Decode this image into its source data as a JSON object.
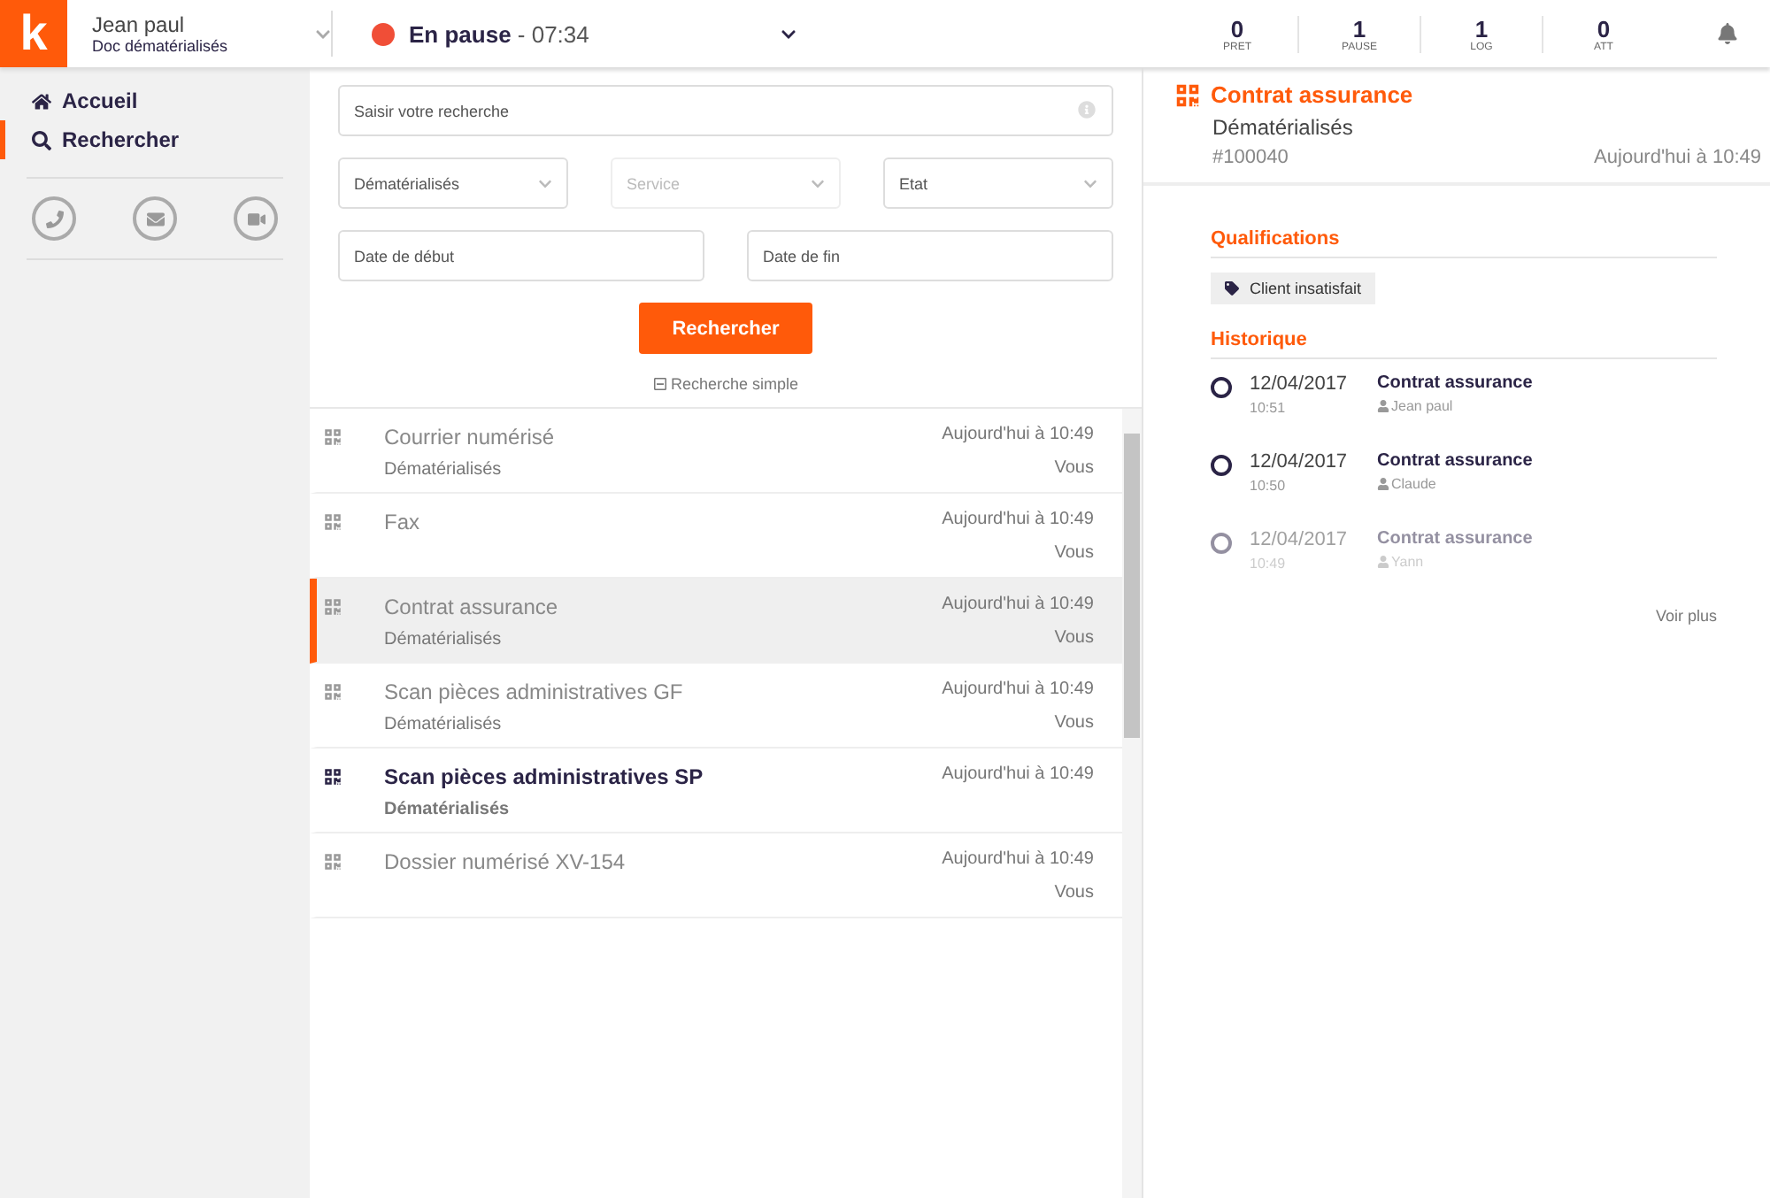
{
  "logo": "k",
  "user": {
    "name": "Jean paul",
    "group": "Doc dématérialisés"
  },
  "status": {
    "label": "En pause",
    "time": " - 07:34",
    "color": "#f04e37"
  },
  "counters": [
    {
      "value": "0",
      "label": "PRET"
    },
    {
      "value": "1",
      "label": "PAUSE"
    },
    {
      "value": "1",
      "label": "LOG"
    },
    {
      "value": "0",
      "label": "ATT"
    }
  ],
  "nav": [
    {
      "label": "Accueil",
      "selected": false
    },
    {
      "label": "Rechercher",
      "selected": true
    }
  ],
  "search": {
    "placeholder": "Saisir votre recherche",
    "selects": [
      {
        "value": "Dématérialisés",
        "disabled": false
      },
      {
        "placeholder": "Service",
        "disabled": true
      },
      {
        "value": "Etat",
        "disabled": false
      }
    ],
    "dates": [
      {
        "placeholder": "Date de début"
      },
      {
        "placeholder": "Date de fin"
      }
    ],
    "button": "Rechercher",
    "toggle": "Recherche simple"
  },
  "results": [
    {
      "title": "Courrier numérisé",
      "subtitle": "Dématérialisés",
      "time": "Aujourd'hui à 10:49",
      "author": "Vous",
      "selected": false,
      "unread": false
    },
    {
      "title": "Fax",
      "time": "Aujourd'hui à 10:49",
      "author": "Vous",
      "selected": false,
      "unread": false
    },
    {
      "title": "Contrat assurance",
      "subtitle": "Dématérialisés",
      "time": "Aujourd'hui à 10:49",
      "author": "Vous",
      "selected": true,
      "unread": false
    },
    {
      "title": "Scan pièces administratives GF",
      "subtitle": "Dématérialisés",
      "time": "Aujourd'hui à 10:49",
      "author": "Vous",
      "selected": false,
      "unread": false
    },
    {
      "title": "Scan pièces administratives SP",
      "subtitle": "Dématérialisés",
      "time": "Aujourd'hui à 10:49",
      "selected": false,
      "unread": true
    },
    {
      "title": "Dossier numérisé XV-154",
      "time": "Aujourd'hui à 10:49",
      "author": "Vous",
      "selected": false,
      "unread": false
    }
  ],
  "detail": {
    "title": "Contrat assurance",
    "category": "Dématérialisés",
    "id": "#100040",
    "time": "Aujourd'hui à 10:49",
    "qualifications_title": "Qualifications",
    "tags": [
      "Client insatisfait"
    ],
    "history_title": "Historique",
    "history": [
      {
        "date": "12/04/2017",
        "time": "10:51",
        "title": "Contrat assurance",
        "user": "Jean paul",
        "faded": false
      },
      {
        "date": "12/04/2017",
        "time": "10:50",
        "title": "Contrat assurance",
        "user": "Claude",
        "faded": false
      },
      {
        "date": "12/04/2017",
        "time": "10:49",
        "title": "Contrat assurance",
        "user": "Yann",
        "faded": true
      }
    ],
    "more": "Voir plus"
  }
}
